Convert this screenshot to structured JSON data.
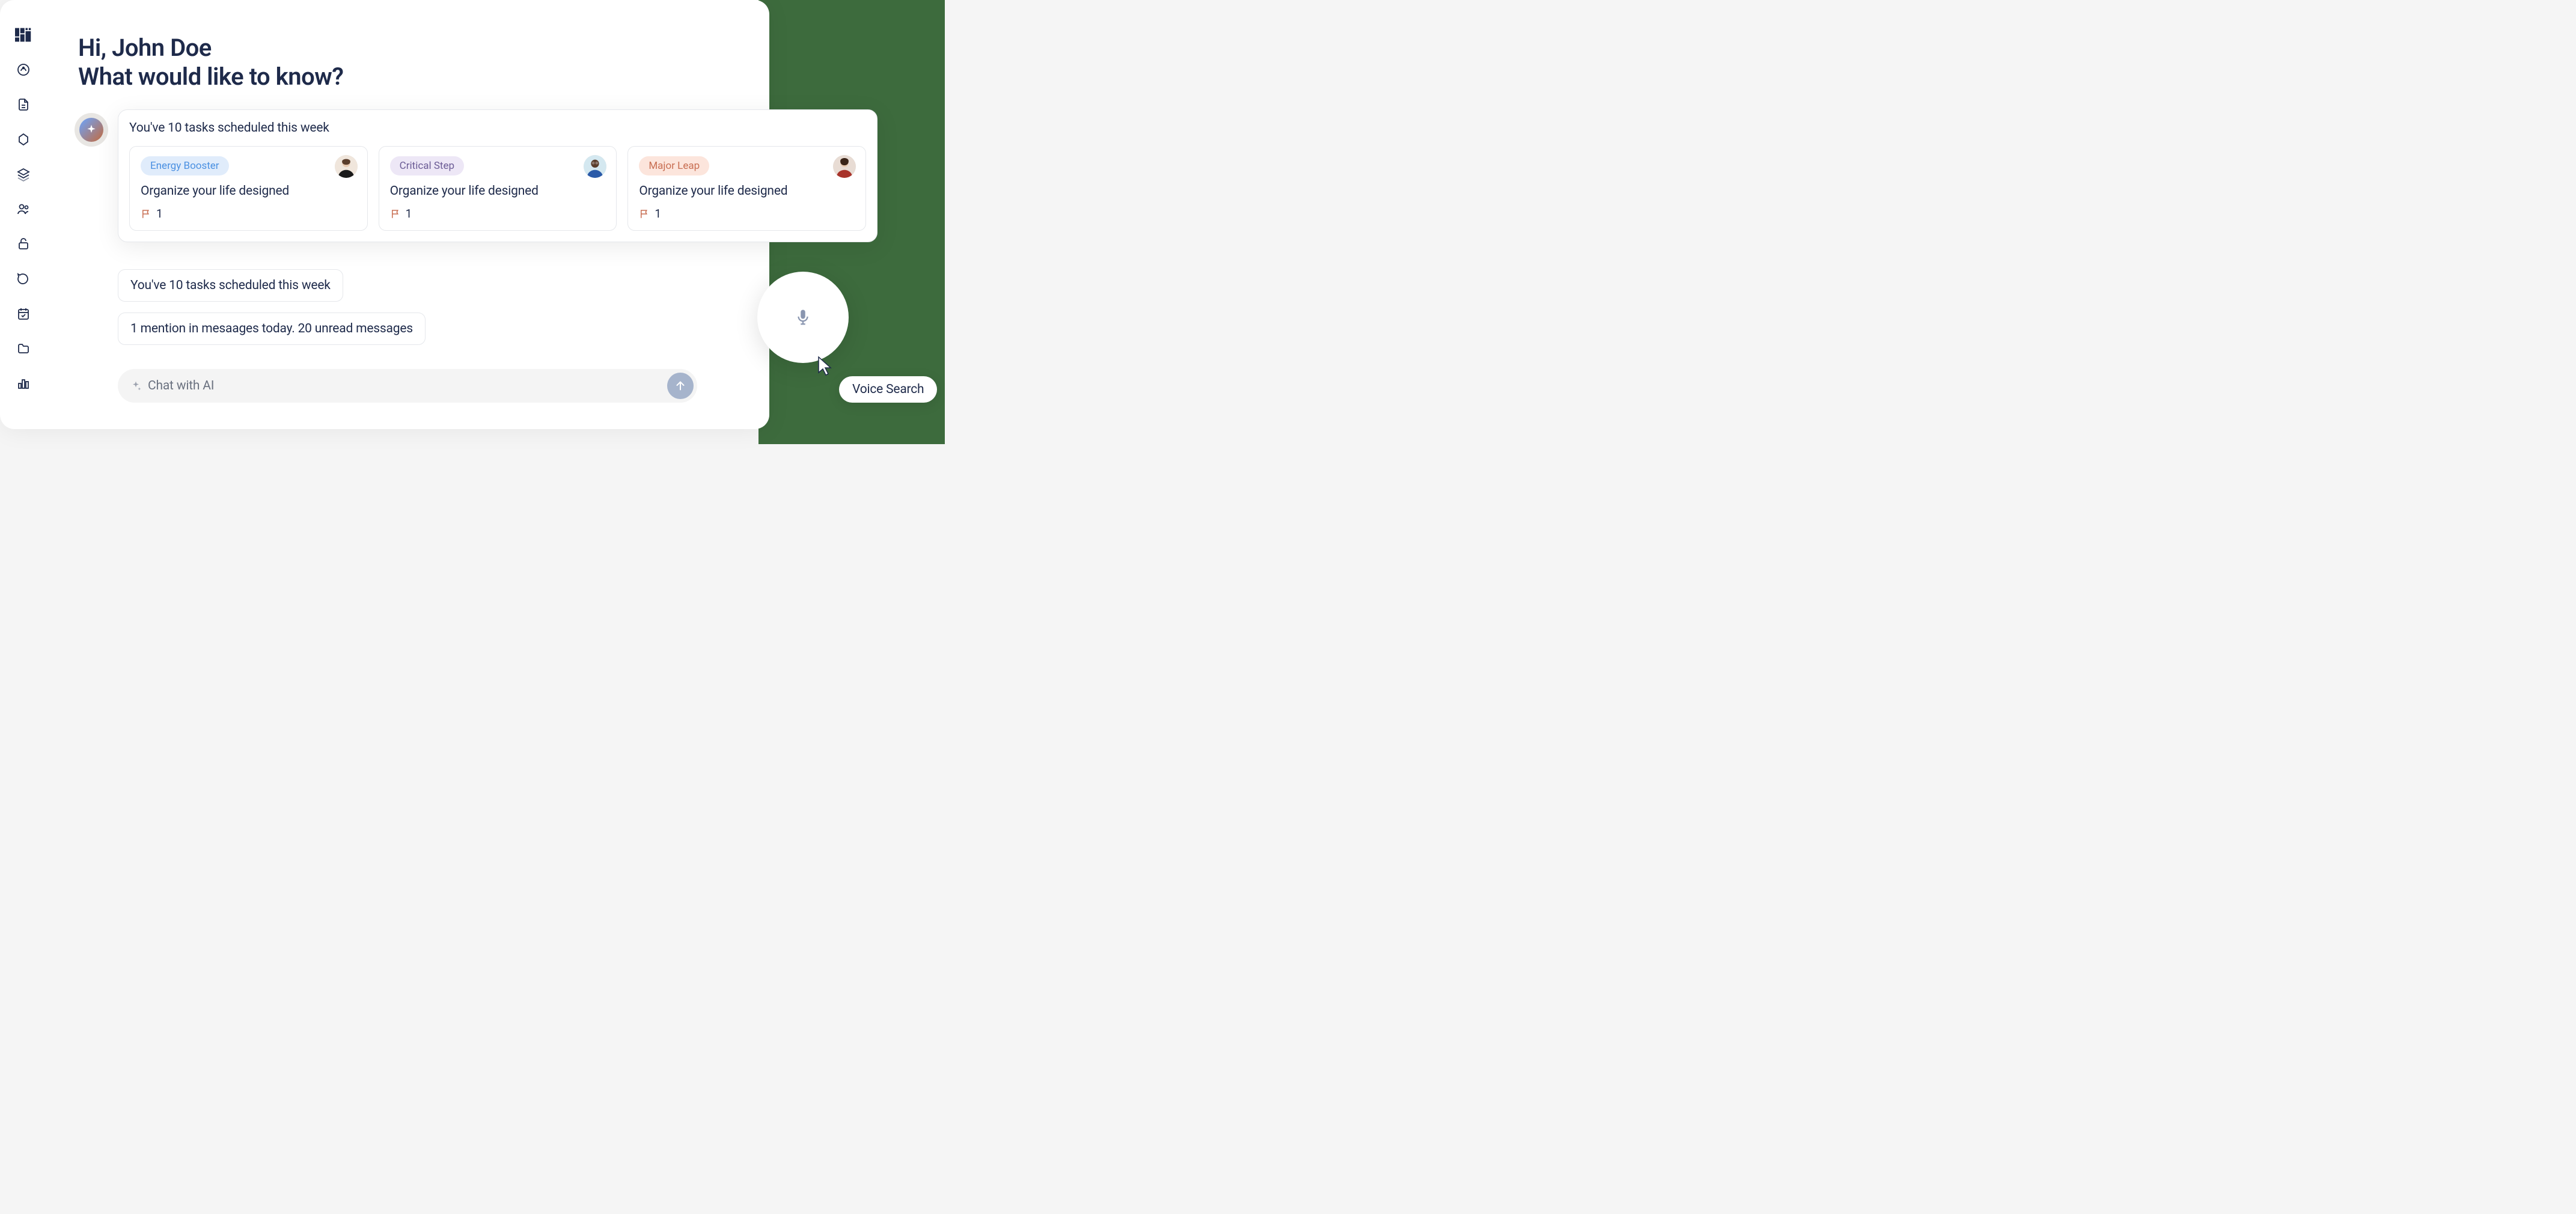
{
  "heading": {
    "line1": "Hi, John Doe",
    "line2": "What would like to know?"
  },
  "tasks_card": {
    "title": "You've 10 tasks scheduled this week",
    "items": [
      {
        "tag": "Energy Booster",
        "tag_class": "tag-blue",
        "title": "Organize your life designed",
        "flag_count": "1"
      },
      {
        "tag": "Critical Step",
        "tag_class": "tag-purple",
        "title": "Organize your life designed",
        "flag_count": "1"
      },
      {
        "tag": "Major Leap",
        "tag_class": "tag-orange",
        "title": "Organize your life designed",
        "flag_count": "1"
      }
    ]
  },
  "pills": {
    "p1": "You've 10 tasks scheduled this week",
    "p2": "1 mention in mesaages today. 20 unread messages"
  },
  "chat": {
    "placeholder": "Chat with AI"
  },
  "voice": {
    "label": "Voice Search"
  }
}
